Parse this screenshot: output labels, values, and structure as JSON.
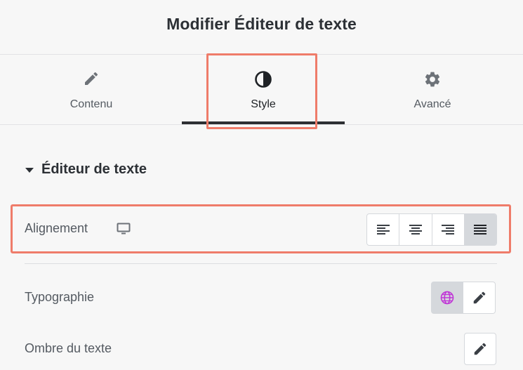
{
  "header": {
    "title": "Modifier Éditeur de texte"
  },
  "tabs": [
    {
      "label": "Contenu",
      "icon": "pencil-icon"
    },
    {
      "label": "Style",
      "icon": "contrast-icon",
      "active": true
    },
    {
      "label": "Avancé",
      "icon": "gear-icon"
    }
  ],
  "section": {
    "title": "Éditeur de texte",
    "expanded": true
  },
  "alignment": {
    "label": "Alignement",
    "device_icon": "desktop-icon",
    "options": [
      "align-left-icon",
      "align-center-icon",
      "align-right-icon",
      "align-justify-icon"
    ],
    "selected": "align-justify-icon"
  },
  "typography": {
    "label": "Typographie",
    "global_icon": "globe-icon",
    "edit_icon": "pencil-icon"
  },
  "text_shadow": {
    "label": "Ombre du texte",
    "edit_icon": "pencil-icon"
  },
  "colors": {
    "highlight": "#ef7c6a",
    "accent_globe": "#c036d6",
    "tab_underline": "#2d2f33"
  }
}
